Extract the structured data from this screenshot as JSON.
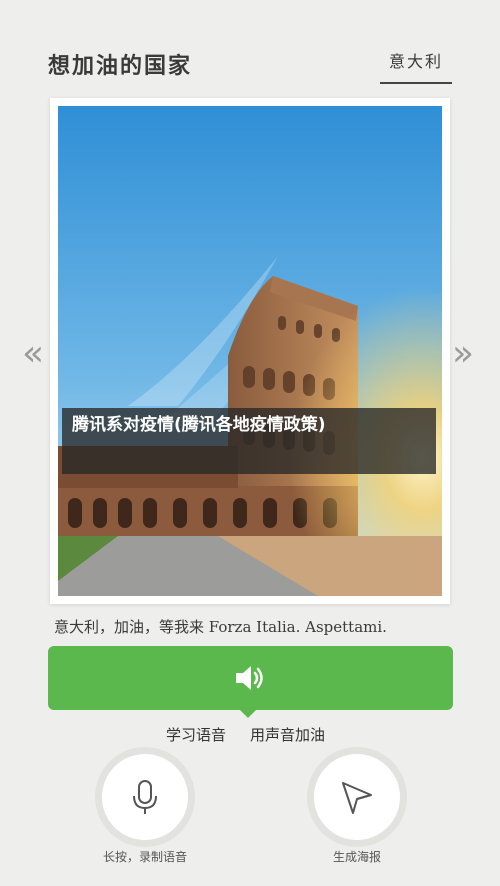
{
  "header": {
    "title": "想加油的国家",
    "country": "意大利"
  },
  "photo": {
    "subject": "colosseum-photo",
    "caption_overlay": "腾讯系对疫情(腾讯各地疫情政策)"
  },
  "nav": {
    "prev": "«",
    "next": "»"
  },
  "cheer_text": "意大利，加油，等我来   Forza Italia. Aspettami.",
  "voice": {
    "icon": "speaker-icon",
    "tabs": [
      "学习语音",
      "用声音加油"
    ]
  },
  "actions": [
    {
      "icon": "microphone-icon",
      "label": "长按，录制语音"
    },
    {
      "icon": "send-icon",
      "label": "生成海报"
    }
  ],
  "colors": {
    "accent_green": "#5ab84c",
    "background": "#eeeeec"
  }
}
